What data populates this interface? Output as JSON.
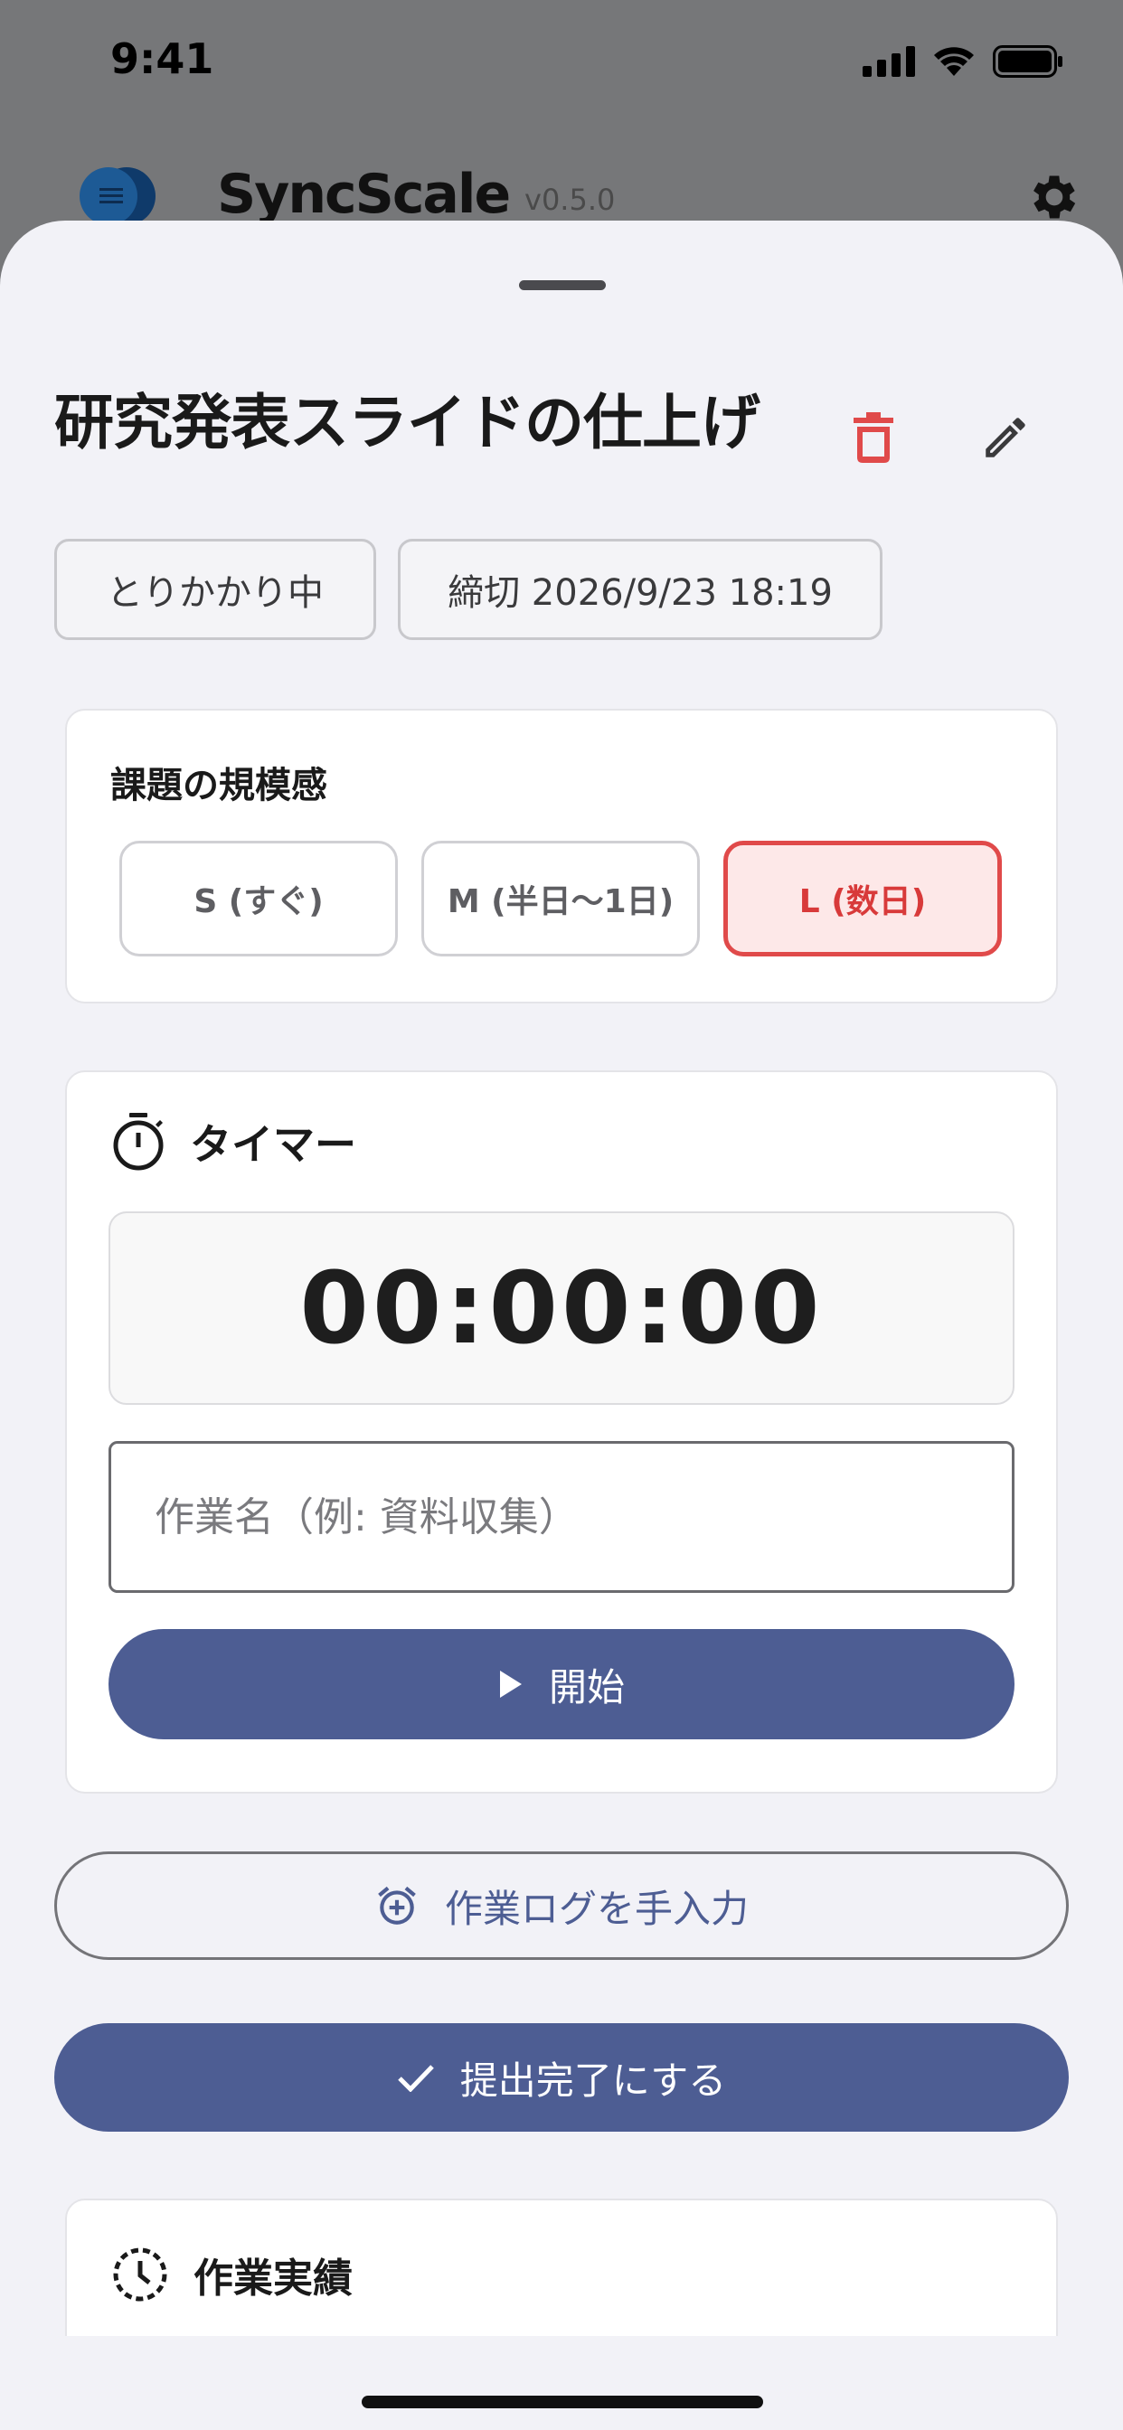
{
  "status_bar": {
    "time": "9:41"
  },
  "app_header": {
    "name": "SyncScale",
    "version": "v0.5.0"
  },
  "sheet": {
    "title": "研究発表スライドの仕上げ",
    "chips": {
      "status": "とりかかり中",
      "deadline": "締切 2026/9/23 18:19"
    },
    "scale": {
      "label": "課題の規模感",
      "options": [
        "S (すぐ)",
        "M (半日〜1日)",
        "L (数日)"
      ],
      "selected": "L (数日)"
    },
    "timer": {
      "label": "タイマー",
      "display": "00:00:00",
      "input_placeholder": "作業名（例: 資料収集）",
      "start_label": "開始"
    },
    "manual_log_label": "作業ログを手入力",
    "submit_label": "提出完了にする",
    "history": {
      "label": "作業実績"
    }
  },
  "colors": {
    "primary": "#4d5d93",
    "danger": "#e04a4a",
    "selected_bg": "#fde8e8",
    "sheet_bg": "#f2f2f7"
  },
  "icons": [
    "signal-icon",
    "wifi-icon",
    "battery-icon",
    "menu-icon",
    "gear-icon",
    "trash-icon",
    "pencil-icon",
    "stopwatch-icon",
    "play-icon",
    "alarm-add-icon",
    "check-icon",
    "history-icon"
  ]
}
